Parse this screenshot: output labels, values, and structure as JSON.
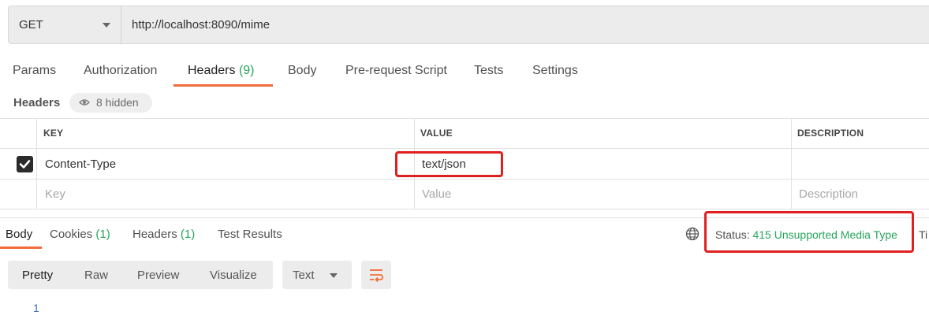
{
  "request": {
    "method": "GET",
    "url": "http://localhost:8090/mime"
  },
  "request_tabs": {
    "params": "Params",
    "authorization": "Authorization",
    "headers": "Headers",
    "headers_count": "(9)",
    "body": "Body",
    "prerequest": "Pre-request Script",
    "tests": "Tests",
    "settings": "Settings"
  },
  "headers_section": {
    "label": "Headers",
    "hidden": "8 hidden"
  },
  "table": {
    "columns": {
      "key": "KEY",
      "value": "VALUE",
      "description": "DESCRIPTION"
    },
    "rows": [
      {
        "checked": true,
        "key": "Content-Type",
        "value": "text/json",
        "description": ""
      }
    ],
    "placeholder": {
      "key": "Key",
      "value": "Value",
      "description": "Description"
    }
  },
  "response_tabs": {
    "body": "Body",
    "cookies": "Cookies",
    "cookies_count": "(1)",
    "headers": "Headers",
    "headers_count": "(1)",
    "test_results": "Test Results"
  },
  "status": {
    "label": "Status:",
    "value": "415 Unsupported Media Type",
    "time_label_partial": "Ti"
  },
  "view_modes": {
    "pretty": "Pretty",
    "raw": "Raw",
    "preview": "Preview",
    "visualize": "Visualize"
  },
  "format": "Text",
  "editor": {
    "line_numbers": [
      "1"
    ]
  },
  "colors": {
    "accent": "#f26b3a",
    "success": "#26a65b",
    "highlight_border": "#e0201f"
  }
}
